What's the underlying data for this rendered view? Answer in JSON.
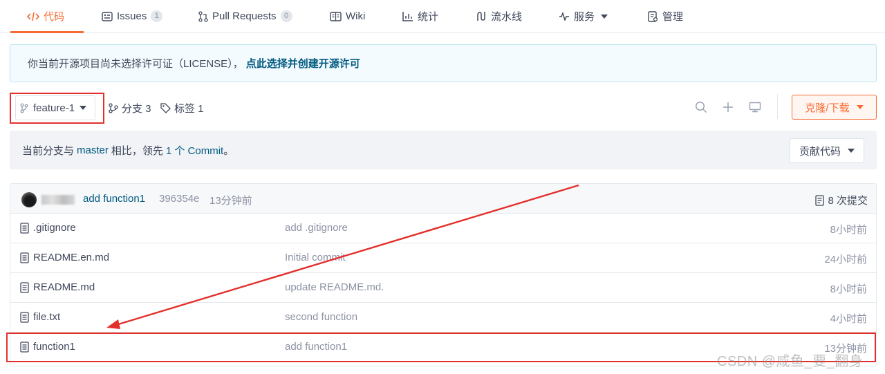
{
  "tabs": [
    {
      "label": "代码",
      "icon": "code-icon",
      "active": true
    },
    {
      "label": "Issues",
      "icon": "issues-icon",
      "badge": "1"
    },
    {
      "label": "Pull Requests",
      "icon": "pull-request-icon",
      "badge": "0"
    },
    {
      "label": "Wiki",
      "icon": "wiki-icon"
    },
    {
      "label": "统计",
      "icon": "stats-icon"
    },
    {
      "label": "流水线",
      "icon": "pipeline-icon"
    },
    {
      "label": "服务",
      "icon": "service-icon",
      "dropdown": true
    },
    {
      "label": "管理",
      "icon": "settings-icon"
    }
  ],
  "banner": {
    "text": "你当前开源项目尚未选择许可证（LICENSE），",
    "link": "点此选择并创建开源许可"
  },
  "branch": {
    "current": "feature-1",
    "branches_label": "分支 3",
    "tags_label": "标签 1",
    "clone_label": "克隆/下载"
  },
  "compare": {
    "prefix": "当前分支与",
    "base": "master",
    "middle": "相比，领先",
    "ahead": "1 个 Commit",
    "suffix": "。",
    "contribute_label": "贡献代码"
  },
  "last_commit": {
    "message": "add function1",
    "hash": "396354e",
    "time": "13分钟前",
    "count_label": "8 次提交"
  },
  "files": [
    {
      "name": ".gitignore",
      "message": "add .gitignore",
      "time": "8小时前"
    },
    {
      "name": "README.en.md",
      "message": "Initial commit",
      "time": "24小时前"
    },
    {
      "name": "README.md",
      "message": "update README.md.",
      "time": "8小时前"
    },
    {
      "name": "file.txt",
      "message": "second function",
      "time": "4小时前"
    },
    {
      "name": "function1",
      "message": "add function1",
      "time": "13分钟前"
    }
  ],
  "watermark": "CSDN @咸鱼_要_翻身",
  "colors": {
    "accent": "#f86b33",
    "link": "#005980",
    "annotation": "#e3302c"
  }
}
